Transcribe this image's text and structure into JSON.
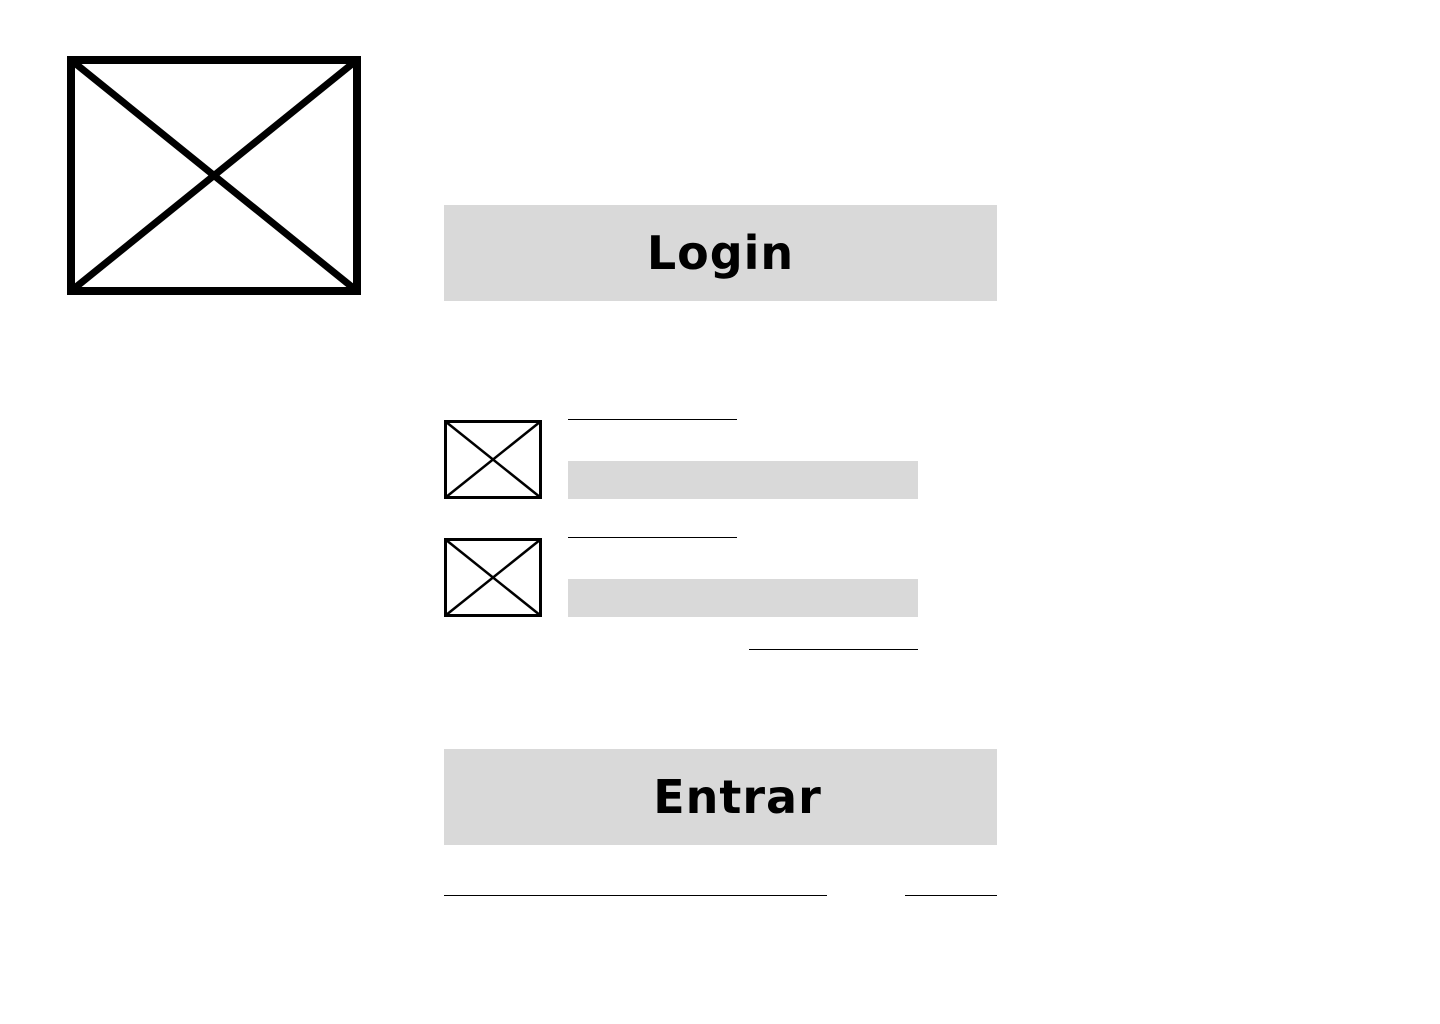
{
  "header": {
    "logo_icon": "image-placeholder-icon",
    "title": "Login"
  },
  "form": {
    "username": {
      "icon": "image-placeholder-icon",
      "value": "",
      "placeholder": ""
    },
    "password": {
      "icon": "image-placeholder-icon",
      "value": "",
      "placeholder": ""
    },
    "submit_label": "Entrar"
  },
  "colors": {
    "block_fill": "#d9d9d9",
    "stroke": "#000000",
    "background": "#ffffff"
  }
}
